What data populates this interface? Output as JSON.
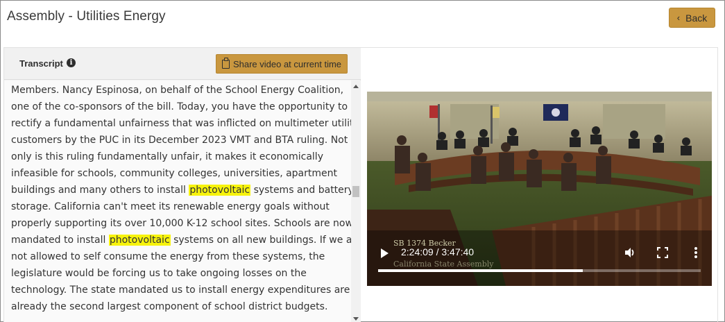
{
  "page": {
    "title": "Assembly - Utilities Energy",
    "back_label": "Back"
  },
  "transcript": {
    "label": "Transcript",
    "share_label": "Share video at current time",
    "lines": [
      [
        {
          "t": "y ...y ... ... ...pp...p... ... ... ... ...,"
        }
      ],
      [
        {
          "t": "Members. Nancy Espinosa, on behalf of the School Energy Coalition,"
        }
      ],
      [
        {
          "t": "one of the co-sponsors of the bill. Today, you have the opportunity to"
        }
      ],
      [
        {
          "t": "rectify a fundamental unfairness that was inflicted on multimeter utility"
        }
      ],
      [
        {
          "t": "customers by the PUC in its December 2023 VMT and BTA ruling. Not"
        }
      ],
      [
        {
          "t": "only is this ruling fundamentally unfair, it makes it economically"
        }
      ],
      [
        {
          "t": "infeasible for schools, community colleges, universities, apartment"
        }
      ],
      [
        {
          "t": "buildings and many others to install "
        },
        {
          "t": "photovoltaic",
          "h": true
        },
        {
          "t": " systems and battery"
        }
      ],
      [
        {
          "t": "storage. California can't meet its renewable energy goals without"
        }
      ],
      [
        {
          "t": "properly supporting its over 10,000 K-12 school sites. Schools are now"
        }
      ],
      [
        {
          "t": "mandated to install "
        },
        {
          "t": "photovoltaic",
          "h": true
        },
        {
          "t": " systems on all new buildings. If we are"
        }
      ],
      [
        {
          "t": "not allowed to self consume the energy from these systems, the"
        }
      ],
      [
        {
          "t": "legislature would be forcing us to take ongoing losses on the"
        }
      ],
      [
        {
          "t": "technology. The state mandated us to install energy expenditures are"
        }
      ],
      [
        {
          "t": "already the second largest component of school district budgets."
        }
      ]
    ]
  },
  "video": {
    "time_display": "2:24:09 / 3:47:40",
    "progress_fraction": 0.634,
    "overlay_line1": "SB 1374          Becker",
    "overlay_line2": "California State Assembly",
    "icons": [
      "play-icon",
      "volume-icon",
      "fullscreen-icon",
      "more-vert-icon"
    ]
  },
  "colors": {
    "accent": "#c9973f",
    "highlight": "#f7f30c"
  }
}
